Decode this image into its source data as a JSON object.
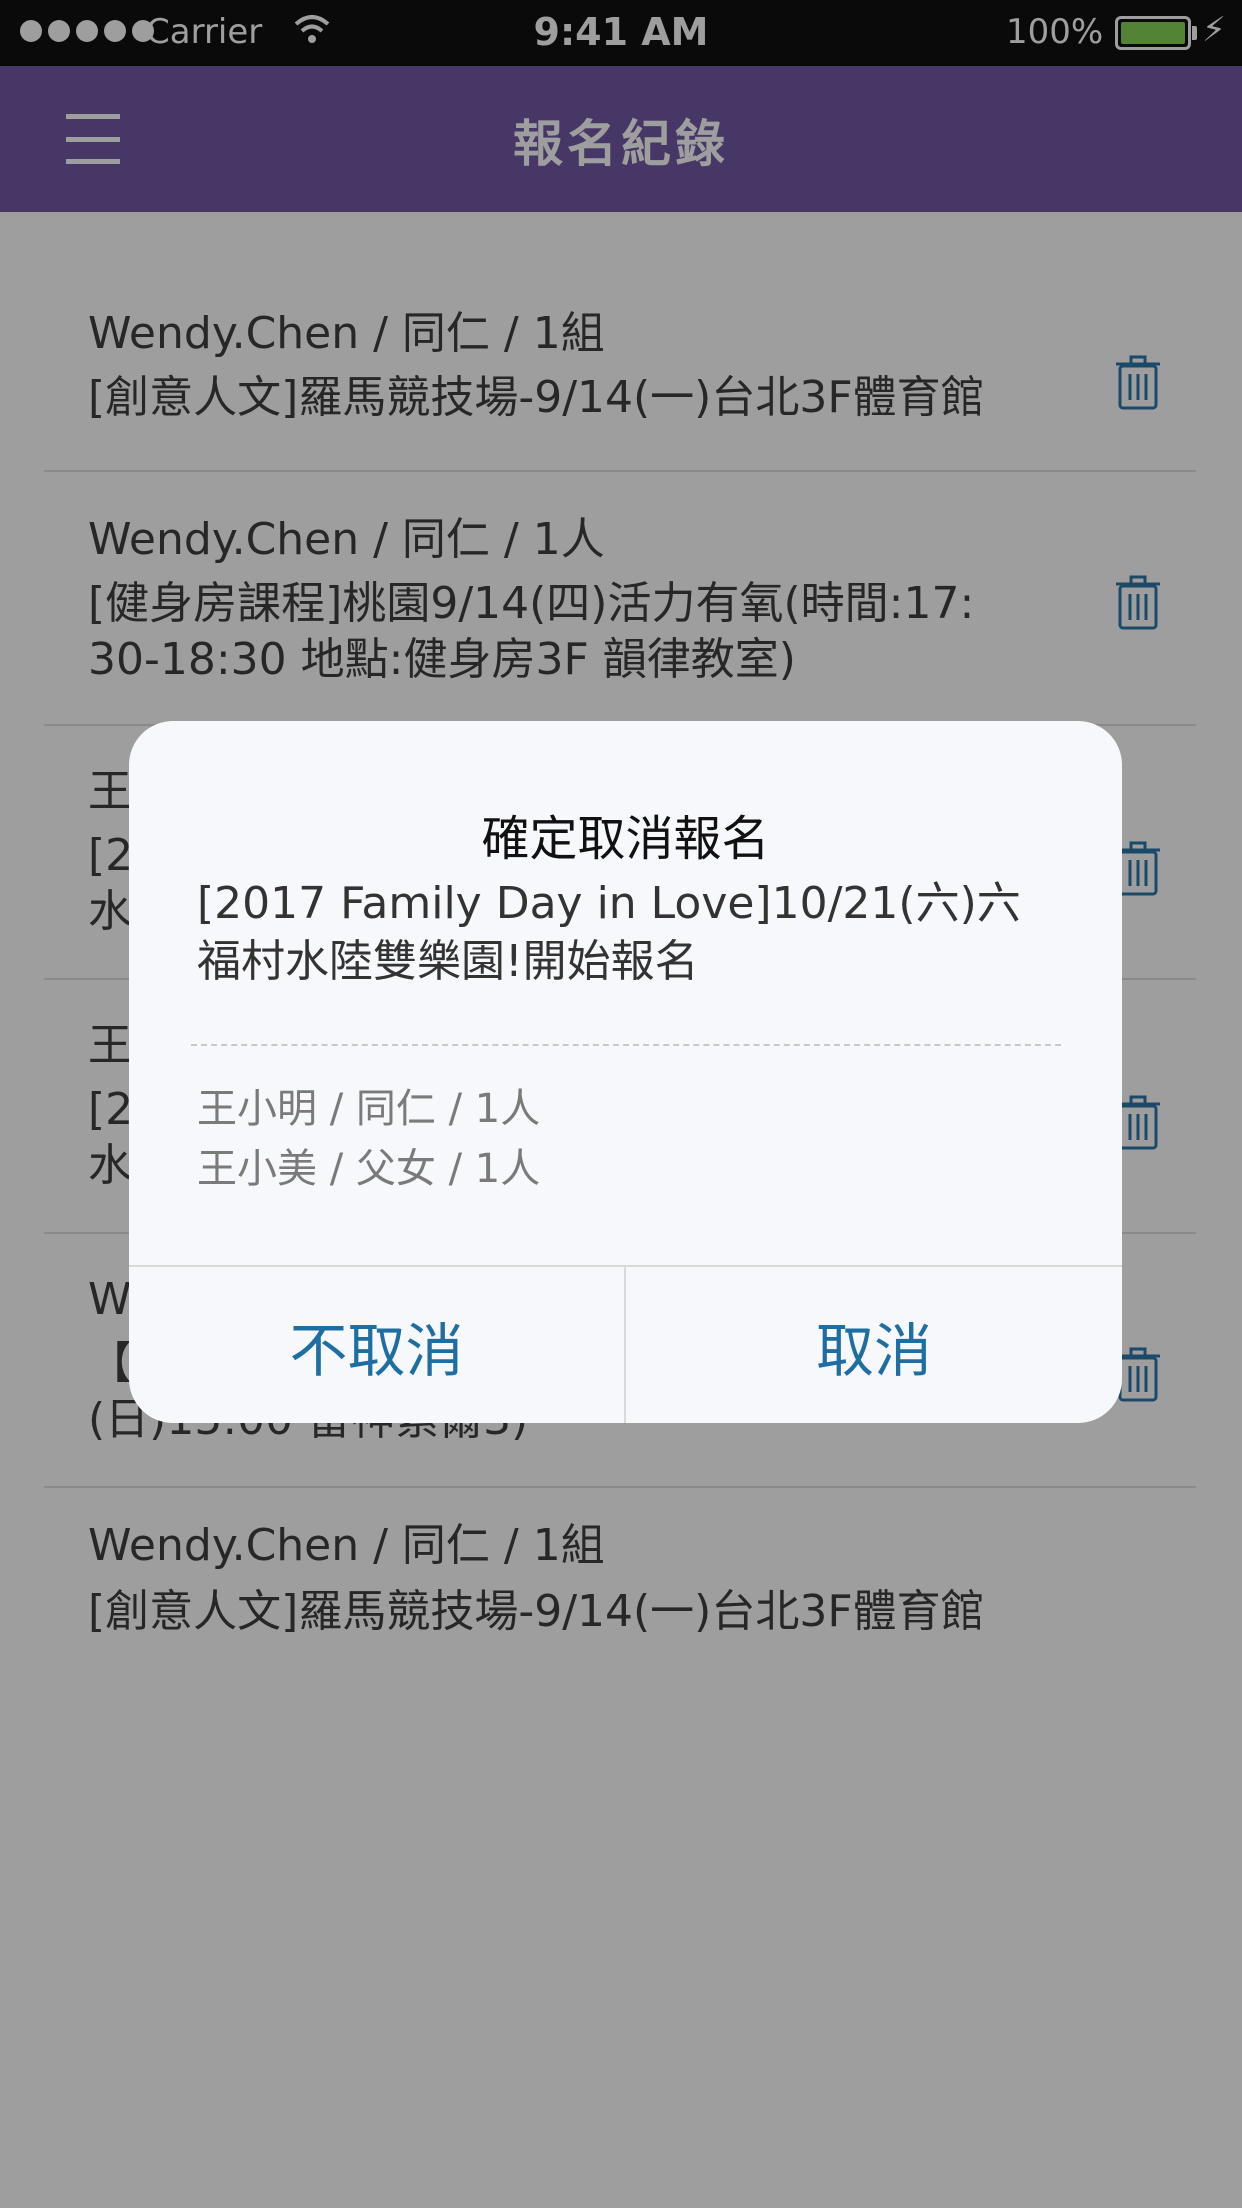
{
  "status_bar": {
    "carrier": "Carrier",
    "time": "9:41 AM",
    "battery": "100%"
  },
  "nav": {
    "title": "報名紀錄",
    "menu_icon": "hamburger-menu-icon"
  },
  "records": [
    {
      "line1": "Wendy.Chen / 同仁 / 1組",
      "line2": "[創意人文]羅馬競技場-9/14(一)台北3F體育館"
    },
    {
      "line1": "Wendy.Chen / 同仁 / 1人",
      "line2": "[健身房課程]桃園9/14(四)活力有氧(時間:17:\n30-18:30 地點:健身房3F 韻律教室)"
    },
    {
      "line1": "王",
      "line2": "[2\n水"
    },
    {
      "line1": "王",
      "line2": "[2\n水"
    },
    {
      "line1": "W",
      "line2": "【\n(日)15:00 雷神索爾3)"
    },
    {
      "line1": "Wendy.Chen / 同仁 / 1組",
      "line2": "[創意人文]羅馬競技場-9/14(一)台北3F體育館"
    }
  ],
  "icons": {
    "trash": "trash-icon"
  },
  "dialog": {
    "title": "確定取消報名",
    "event": "[2017 Family Day in Love]10/21(六)六福村水陸雙樂園!開始報名",
    "people": [
      "王小明 / 同仁 / 1人",
      "王小美 / 父女 / 1人"
    ],
    "keep_label": "不取消",
    "cancel_label": "取消"
  },
  "colors": {
    "nav_background": "#6a4ea0",
    "accent_blue": "#1e6ea3",
    "battery_green": "#7ed04a"
  }
}
